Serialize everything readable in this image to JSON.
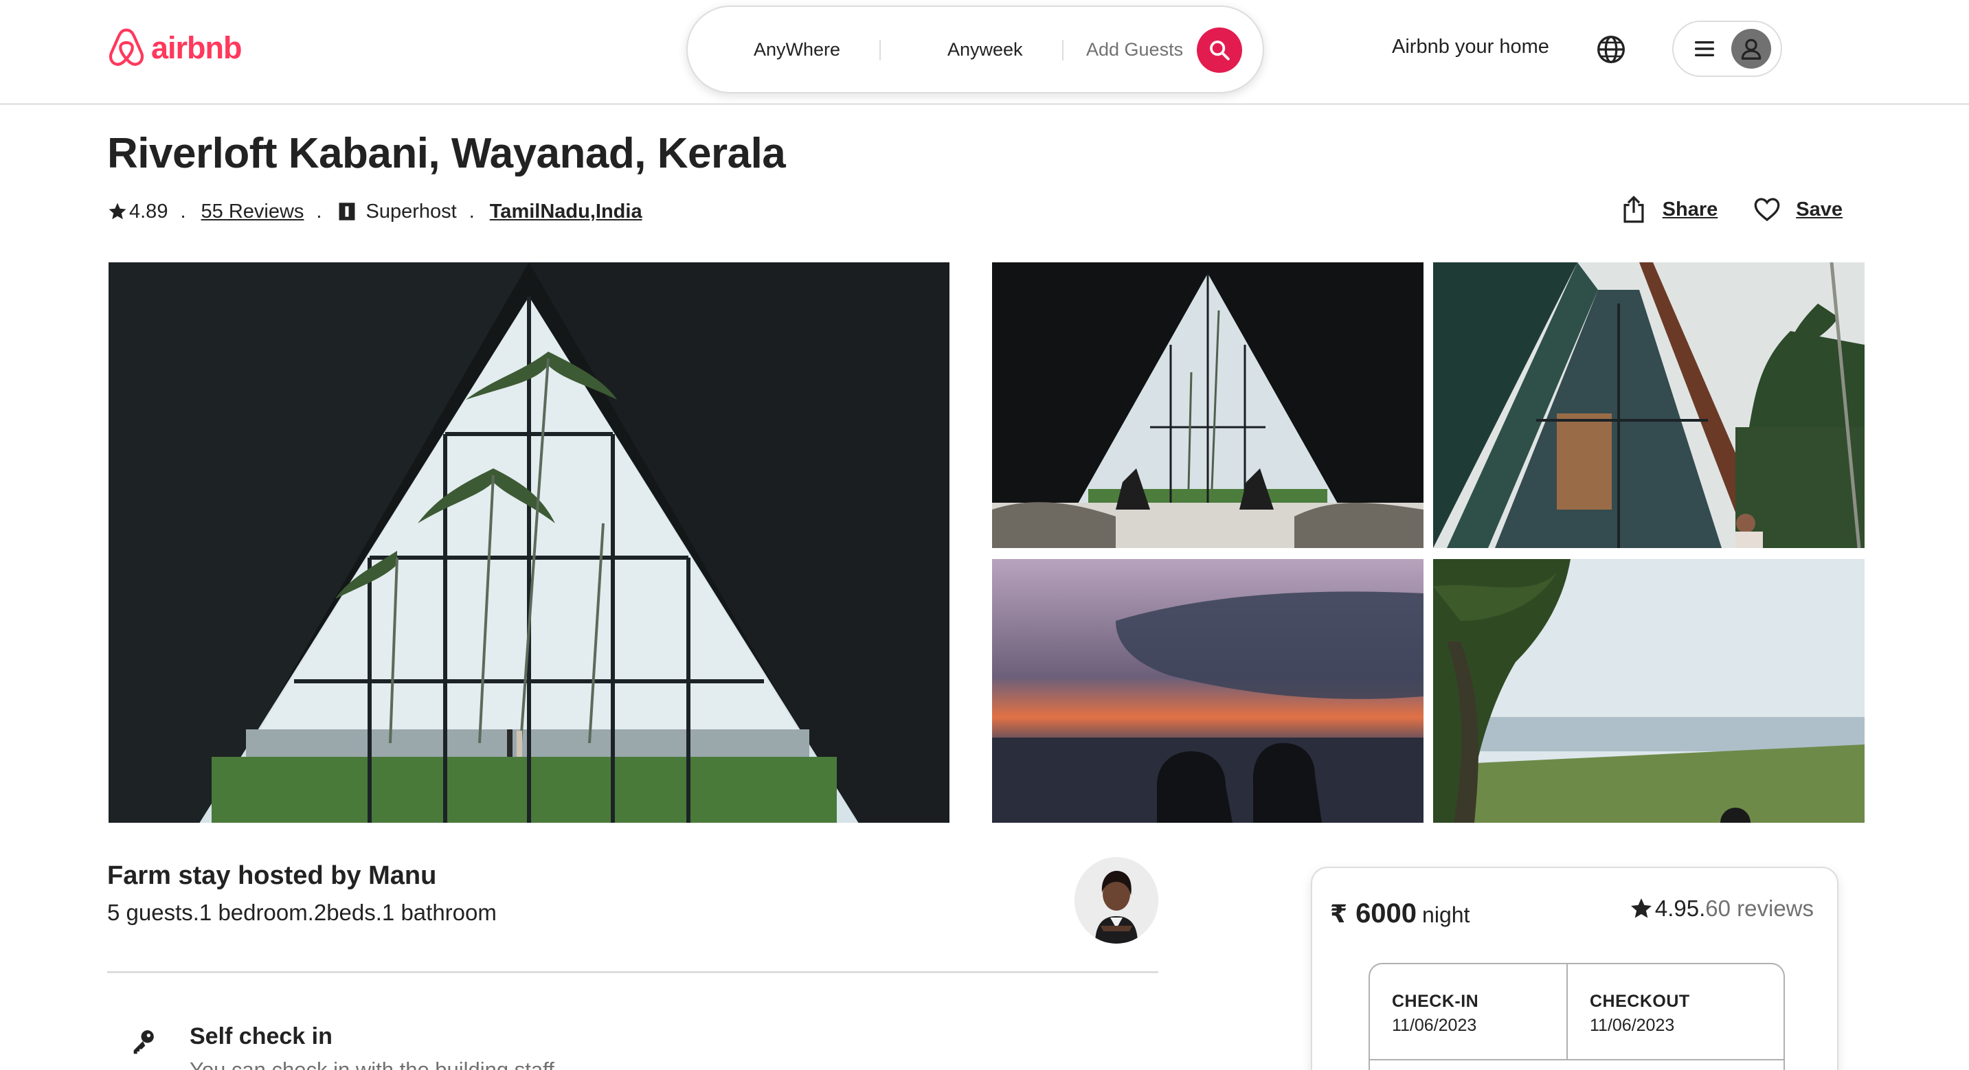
{
  "header": {
    "logo_text": "airbnb",
    "search": {
      "where": "AnyWhere",
      "week": "Anyweek",
      "guests": "Add Guests"
    },
    "host_link": "Airbnb your home",
    "icons": [
      "airbnb-logo-icon",
      "search-icon",
      "globe-icon",
      "hamburger-icon",
      "user-icon"
    ],
    "brand_color": "#FF385C"
  },
  "listing": {
    "title": "Riverloft Kabani, Wayanad, Kerala",
    "rating": "4.89",
    "separator": ".",
    "reviews": "55 Reviews",
    "host_badge": "Superhost",
    "location": "TamilNadu,India",
    "share_label": "Share",
    "save_label": "Save"
  },
  "host": {
    "title": "Farm stay hosted by Manu",
    "details": "5 guests.1 bedroom.2beds.1 bathroom"
  },
  "features": [
    {
      "icon": "key-icon",
      "title": "Self check in",
      "description": "You can check in with the building staff"
    }
  ],
  "booking": {
    "currency": "₹",
    "price": "6000",
    "unit": "night",
    "rating": "4.95.",
    "reviews": "60 reviews",
    "checkin_label": "CHECK-IN",
    "checkin_value": "11/06/2023",
    "checkout_label": "CHECKOUT",
    "checkout_value": "11/06/2023"
  }
}
